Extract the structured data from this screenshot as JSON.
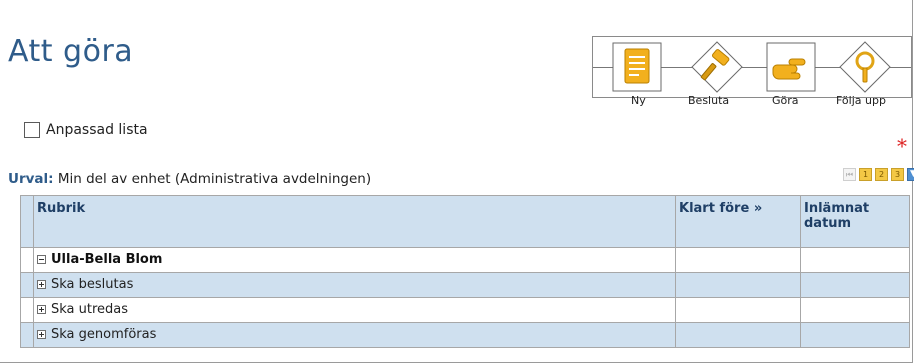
{
  "page": {
    "title": "Att göra"
  },
  "workflow": {
    "steps": [
      {
        "label": "Ny",
        "icon": "document-icon",
        "color": "#f2b01e"
      },
      {
        "label": "Besluta",
        "icon": "gavel-icon",
        "color": "#f2b01e"
      },
      {
        "label": "Göra",
        "icon": "hand-icon",
        "color": "#f2b01e"
      },
      {
        "label": "Följa upp",
        "icon": "magnifier-icon",
        "color": "#f2b01e"
      }
    ]
  },
  "custom_list": {
    "label": "Anpassad lista",
    "checked": false
  },
  "required_marker": "*",
  "filter": {
    "label": "Urval:",
    "value": "Min del av enhet (Administrativa avdelningen)"
  },
  "pager": {
    "buttons": [
      "⏮",
      "1",
      "2",
      "3",
      "▼"
    ]
  },
  "table": {
    "headers": {
      "rubrik": "Rubrik",
      "klart_fore": "Klart före",
      "sort_marker": "»",
      "inlamnat": "Inlämnat datum"
    },
    "group": {
      "name": "Ulla-Bella Blom"
    },
    "rows": [
      {
        "label": "Ska beslutas"
      },
      {
        "label": "Ska utredas"
      },
      {
        "label": "Ska genomföras"
      }
    ]
  },
  "colors": {
    "accent": "#2f5c8a",
    "header_bg": "#cfe0ef",
    "required": "#dd2222"
  }
}
